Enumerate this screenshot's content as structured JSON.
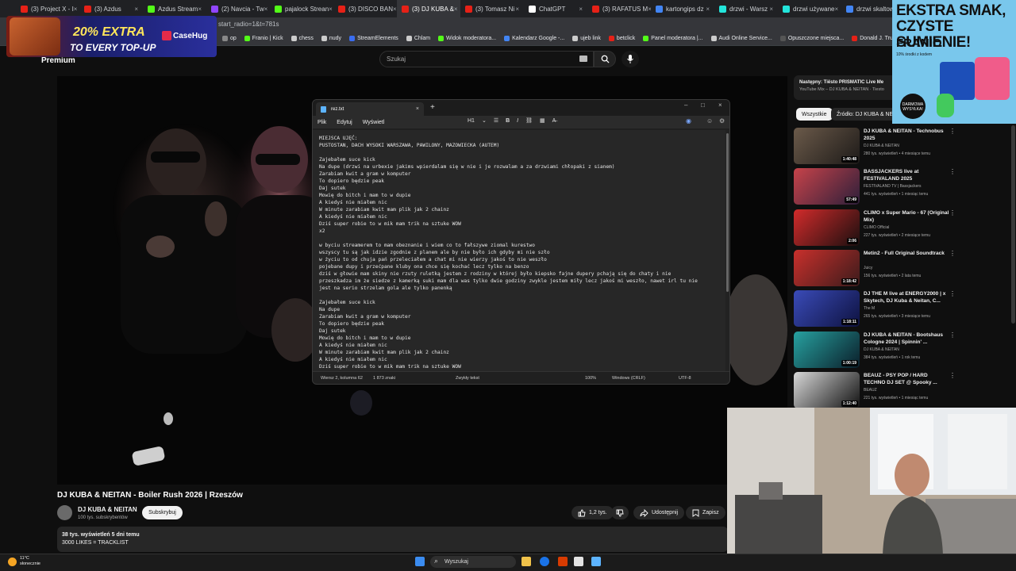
{
  "browser": {
    "tabs": [
      {
        "label": "(3) Project X - I",
        "color": "#e62117"
      },
      {
        "label": "(3) Azdus",
        "color": "#e62117"
      },
      {
        "label": "Azdus Stream",
        "color": "#53fc18"
      },
      {
        "label": "(2) Navcia - Tw",
        "color": "#9146ff"
      },
      {
        "label": "pajalock Strean",
        "color": "#53fc18"
      },
      {
        "label": "(3) DISCO BAN",
        "color": "#e62117"
      },
      {
        "label": "(3) DJ KUBA &",
        "color": "#e62117"
      },
      {
        "label": "(3) Tomasz Ni",
        "color": "#e62117"
      },
      {
        "label": "ChatGPT",
        "color": "#ffffff"
      },
      {
        "label": "(3) RAFATUS M",
        "color": "#e62117"
      },
      {
        "label": "kartongips dz",
        "color": "#4285f4"
      },
      {
        "label": "drzwi - Warsz",
        "color": "#23e5db"
      },
      {
        "label": "drzwi używane",
        "color": "#23e5db"
      },
      {
        "label": "drzwi skaltow",
        "color": "#4285f4"
      },
      {
        "label": "pog",
        "color": "#4285f4"
      }
    ],
    "url_fragment": "start_radio=1&t=781s",
    "bookmarks": [
      {
        "label": "op",
        "color": "#888888"
      },
      {
        "label": "Franio | Kick",
        "color": "#53fc18"
      },
      {
        "label": "chess",
        "color": "#cccccc"
      },
      {
        "label": "nudy",
        "color": "#cccccc"
      },
      {
        "label": "StreamElements",
        "color": "#3a6df0"
      },
      {
        "label": "Chlam",
        "color": "#cccccc"
      },
      {
        "label": "Widok moderatora...",
        "color": "#53fc18"
      },
      {
        "label": "Kalendarz Google -...",
        "color": "#4285f4"
      },
      {
        "label": "ujeb link",
        "color": "#cccccc"
      },
      {
        "label": "betclick",
        "color": "#e62117"
      },
      {
        "label": "Panel moderatora |...",
        "color": "#53fc18"
      },
      {
        "label": "Audi Online Service...",
        "color": "#cccccc"
      },
      {
        "label": "Opuszczone miejsca...",
        "color": "#555555"
      },
      {
        "label": "Donald J. Trump ne...",
        "color": "#e62117"
      }
    ]
  },
  "ads": {
    "casehug_line1": "20% EXTRA",
    "casehug_line2": "TO EVERY TOP-UP",
    "casehug_brand": "CaseHug",
    "franio_headline": "EKSTRA SMAK, CZYSTE SUMIENIE!",
    "franio_brand": "FRANIO",
    "franio_sub": "10% środki z kodem",
    "franio_badge": "DARMOWA WYSYŁKA!"
  },
  "youtube": {
    "premium": "Premium",
    "search_placeholder": "Szukaj",
    "video_title": "DJ KUBA & NEITAN - Boiler Rush 2026 | Rzeszów",
    "channel_name": "DJ KUBA & NEITAN",
    "channel_subs": "100 tys. subskrybentów",
    "subscribe": "Subskrybuj",
    "likes": "1,2 tys.",
    "share": "Udostępnij",
    "save": "Zapisz",
    "desc_stats": "38 tys. wyświetleń  5 dni temu",
    "desc_text": "3000 LIKES = TRACKLIST",
    "next_title": "Następny: Tiësto PRISMATIC Live Me",
    "next_sub": "YouTube Mix – DJ KUBA & NEITAN · Tiesto",
    "chip_all": "Wszystkie",
    "chip_src": "Źródło: DJ KUBA & NE",
    "recs": [
      {
        "title": "DJ KUBA & NEITAN - Technobus 2025",
        "channel": "DJ KUBA & NEITAN",
        "meta": "280 tys. wyświetleń • 4 miesiące temu",
        "duration": "1:40:48",
        "c1": "#6b5a4a",
        "c2": "#1d1a18"
      },
      {
        "title": "BASSJACKERS live at FESTIVALAND 2025",
        "channel": "FESTIVALAND TV | Bassjackers",
        "meta": "441 tys. wyświetleń • 1 miesiąc temu",
        "duration": "57:49",
        "c1": "#c7434a",
        "c2": "#2d1f3a"
      },
      {
        "title": "CLIMO x Super Mario - 67 (Original Mix)",
        "channel": "CLIMO Official",
        "meta": "227 tys. wyświetleń • 2 miesiące temu",
        "duration": "2:06",
        "c1": "#d22b2b",
        "c2": "#1a0f0f"
      },
      {
        "title": "Metin2 - Full Original Soundtrack",
        "channel": "Juicy",
        "meta": "156 tys. wyświetleń • 2 lata temu",
        "duration": "1:18:42",
        "c1": "#c9302c",
        "c2": "#3b1b1b"
      },
      {
        "title": "DJ THE M live at ENERGY2000 | x Skytech, DJ Kuba & Neitan, C...",
        "channel": "The M",
        "meta": "265 tys. wyświetleń • 3 miesiące temu",
        "duration": "1:18:11",
        "c1": "#3a4bb8",
        "c2": "#0e1240"
      },
      {
        "title": "DJ KUBA & NEITAN - Bootshaus Cologne 2024 | Spinnin' ...",
        "channel": "DJ KUBA & NEITAN",
        "meta": "384 tys. wyświetleń • 1 rok temu",
        "duration": "1:00:19",
        "c1": "#27a1a0",
        "c2": "#0b1f2a"
      },
      {
        "title": "BEAUZ - PSY POP / HARD TECHNO DJ SET @ Spooky ...",
        "channel": "BEAUZ",
        "meta": "221 tys. wyświetleń • 1 miesiąc temu",
        "duration": "1:12:40",
        "c1": "#d8d8d8",
        "c2": "#111111"
      }
    ]
  },
  "notepad": {
    "tab_name": "rez.txt",
    "menu": [
      "Plik",
      "Edytuj",
      "Wyświetl"
    ],
    "heading": "H1",
    "text": "MIEJSCA UJĘĆ:\nPUSTOSTAN, DACH WYSOKI WARSZAWA, PAWILONY, MAZOWIECKA (AUTEM)\n\nZajebałem suce kick\nNa dupe (drzwi na urbexie jakims wpierdalam się w nie i je rozwalam a za drzwiami chłopaki z sianem)\nZarabiam kwit a gram w komputer\nTo dopiero będzie peak\nDaj sutek\nMowię do bitch i mam to w dupie\nA kiedyś nie miałem nic\nW minute zarabiam kwit mam plik jak 2 chainz\nA kiedyś nie miałem nic\nDziś super robie to w mik mam trik na sztuke WOW\nx2\n\nw byciu streamerem to mam obeznanie i wiem co to fałszywe ziomal kurestwo\nwszyscy tu są jak idzie zgodnie z planem ale by nie było ich gdyby mi nie szło\nw życiu to od chuja pań przeleciałem a chat mi nie wierzy jakoś to nie weszło\npojebane dupy i przećpane kluby ona chce się kochać lecz tylko na benzo\ndziś w głowie mam skiny nie rzuty ruletką jestem z rodziny w której było kiepsko fajne dupery pchają się do chaty i nie\nprzeszkadza im że siedze z kamerką suki mam dla was tylko dwie godziny zwykle jestem miły lecz jakoś mi weszło, nawet irl tu nie\njest na serio strzelam gola ale tylko panenką\n\nZajebałem suce kick\nNa dupe\nZarabiam kwit a gram w komputer\nTo dopiero będzie peak\nDaj sutek\nMowię do bitch i mam to w dupie\nA kiedyś nie miałem nic\nW minute zarabiam kwit mam plik jak 2 chainz\nA kiedyś nie miałem nic\nDziś super robie to w mik mam trik na sztuke WOW",
    "status_pos": "Wiersz 2, kolumna 62",
    "status_chars": "1 873 znaki",
    "status_mode": "Zwykły tekst",
    "status_zoom": "100%",
    "status_eol": "Windows (CRLF)",
    "status_enc": "UTF-8"
  },
  "taskbar": {
    "temp": "11°C",
    "weather": "słonecznie",
    "search": "Wyszukaj"
  }
}
